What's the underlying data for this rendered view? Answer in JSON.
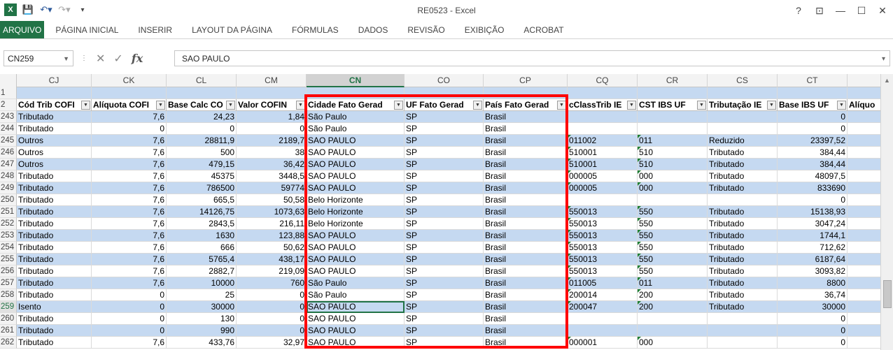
{
  "window": {
    "title": "RE0523 - Excel",
    "help": "?",
    "restore_ribbon": "⊡",
    "minimize": "—",
    "maximize": "☐",
    "close": "✕"
  },
  "ribbon": {
    "tabs": [
      "ARQUIVO",
      "PÁGINA INICIAL",
      "INSERIR",
      "LAYOUT DA PÁGINA",
      "FÓRMULAS",
      "DADOS",
      "REVISÃO",
      "EXIBIÇÃO",
      "ACROBAT"
    ]
  },
  "formula_bar": {
    "name_box": "CN259",
    "formula": "SAO PAULO",
    "fx": "fx"
  },
  "colors": {
    "excel_green": "#217346",
    "band": "#c5d9f1",
    "highlight": "#ff0000"
  },
  "columns": [
    "CJ",
    "CK",
    "CL",
    "CM",
    "CN",
    "CO",
    "CP",
    "CQ",
    "CR",
    "CS",
    "CT"
  ],
  "selected_column": "CN",
  "headers": [
    "Cód Trib COFI",
    "Alíquota COFI",
    "Base Calc CO",
    "Valor COFIN",
    "Cidade Fato Gerad",
    "UF Fato Gerad",
    "País Fato Gerad",
    "cClassTrib IE",
    "CST IBS UF",
    "Tributação IE",
    "Base IBS UF",
    "Alíquo"
  ],
  "row_numbers": [
    "1",
    "2",
    "243",
    "244",
    "245",
    "246",
    "247",
    "248",
    "249",
    "250",
    "251",
    "252",
    "253",
    "254",
    "255",
    "256",
    "257",
    "258",
    "259",
    "260",
    "261",
    "262"
  ],
  "rows": [
    {
      "n": "243",
      "c": [
        "Tributado",
        "7,6",
        "24,23",
        "1,84",
        "São Paulo",
        "SP",
        "Brasil",
        "",
        "",
        "",
        "0"
      ]
    },
    {
      "n": "244",
      "c": [
        "Tributado",
        "0",
        "0",
        "0",
        "São Paulo",
        "SP",
        "Brasil",
        "",
        "",
        "",
        "0"
      ]
    },
    {
      "n": "245",
      "c": [
        "Outros",
        "7,6",
        "28811,9",
        "2189,7",
        "SAO PAULO",
        "SP",
        "Brasil",
        "011002",
        "011",
        "Reduzido",
        "23397,52"
      ]
    },
    {
      "n": "246",
      "c": [
        "Outros",
        "7,6",
        "500",
        "38",
        "SAO PAULO",
        "SP",
        "Brasil",
        "510001",
        "510",
        "Tributado",
        "384,44"
      ]
    },
    {
      "n": "247",
      "c": [
        "Outros",
        "7,6",
        "479,15",
        "36,42",
        "SAO PAULO",
        "SP",
        "Brasil",
        "510001",
        "510",
        "Tributado",
        "384,44"
      ]
    },
    {
      "n": "248",
      "c": [
        "Tributado",
        "7,6",
        "45375",
        "3448,5",
        "SAO PAULO",
        "SP",
        "Brasil",
        "000005",
        "000",
        "Tributado",
        "48097,5"
      ]
    },
    {
      "n": "249",
      "c": [
        "Tributado",
        "7,6",
        "786500",
        "59774",
        "SAO PAULO",
        "SP",
        "Brasil",
        "000005",
        "000",
        "Tributado",
        "833690"
      ]
    },
    {
      "n": "250",
      "c": [
        "Tributado",
        "7,6",
        "665,5",
        "50,58",
        "Belo Horizonte",
        "SP",
        "Brasil",
        "",
        "",
        "",
        "0"
      ]
    },
    {
      "n": "251",
      "c": [
        "Tributado",
        "7,6",
        "14126,75",
        "1073,63",
        "Belo Horizonte",
        "SP",
        "Brasil",
        "550013",
        "550",
        "Tributado",
        "15138,93"
      ]
    },
    {
      "n": "252",
      "c": [
        "Tributado",
        "7,6",
        "2843,5",
        "216,11",
        "Belo Horizonte",
        "SP",
        "Brasil",
        "550013",
        "550",
        "Tributado",
        "3047,24"
      ]
    },
    {
      "n": "253",
      "c": [
        "Tributado",
        "7,6",
        "1630",
        "123,88",
        "SAO PAULO",
        "SP",
        "Brasil",
        "550013",
        "550",
        "Tributado",
        "1744,1"
      ]
    },
    {
      "n": "254",
      "c": [
        "Tributado",
        "7,6",
        "666",
        "50,62",
        "SAO PAULO",
        "SP",
        "Brasil",
        "550013",
        "550",
        "Tributado",
        "712,62"
      ]
    },
    {
      "n": "255",
      "c": [
        "Tributado",
        "7,6",
        "5765,4",
        "438,17",
        "SAO PAULO",
        "SP",
        "Brasil",
        "550013",
        "550",
        "Tributado",
        "6187,64"
      ]
    },
    {
      "n": "256",
      "c": [
        "Tributado",
        "7,6",
        "2882,7",
        "219,09",
        "SAO PAULO",
        "SP",
        "Brasil",
        "550013",
        "550",
        "Tributado",
        "3093,82"
      ]
    },
    {
      "n": "257",
      "c": [
        "Tributado",
        "7,6",
        "10000",
        "760",
        "São Paulo",
        "SP",
        "Brasil",
        "011005",
        "011",
        "Tributado",
        "8800"
      ]
    },
    {
      "n": "258",
      "c": [
        "Tributado",
        "0",
        "25",
        "0",
        "São Paulo",
        "SP",
        "Brasil",
        "200014",
        "200",
        "Tributado",
        "36,74"
      ]
    },
    {
      "n": "259",
      "c": [
        "Isento",
        "0",
        "30000",
        "0",
        "SAO PAULO",
        "SP",
        "Brasil",
        "200047",
        "200",
        "Tributado",
        "30000"
      ]
    },
    {
      "n": "260",
      "c": [
        "Tributado",
        "0",
        "130",
        "0",
        "SAO PAULO",
        "SP",
        "Brasil",
        "",
        "",
        "",
        "0"
      ]
    },
    {
      "n": "261",
      "c": [
        "Tributado",
        "0",
        "990",
        "0",
        "SAO PAULO",
        "SP",
        "Brasil",
        "",
        "",
        "",
        "0"
      ]
    },
    {
      "n": "262",
      "c": [
        "Tributado",
        "7,6",
        "433,76",
        "32,97",
        "SAO PAULO",
        "SP",
        "Brasil",
        "000001",
        "000",
        "",
        "0"
      ]
    }
  ]
}
